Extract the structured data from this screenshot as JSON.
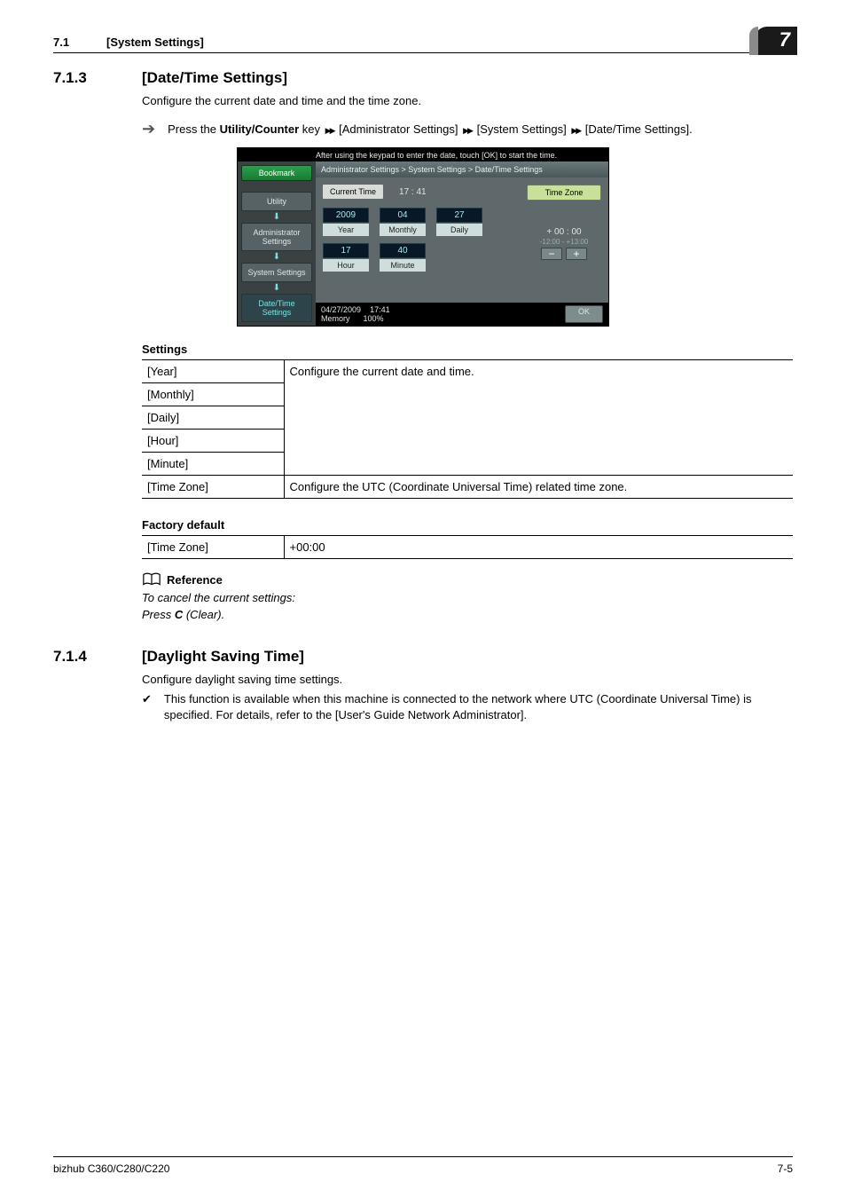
{
  "header": {
    "num": "7.1",
    "text": "[System Settings]",
    "chapter": "7"
  },
  "sec713": {
    "num": "7.1.3",
    "title": "[Date/Time Settings]",
    "intro": "Configure the current date and time and the time zone.",
    "press_pre": "Press the ",
    "press_bold": "Utility/Counter",
    "press_post": " key ",
    "nav1": " [Administrator Settings] ",
    "nav2": " [System Settings] ",
    "nav3": " [Date/Time Settings]."
  },
  "device": {
    "topmsg": "After using the keypad to enter the date, touch [OK] to start the time.",
    "bookmark": "Bookmark",
    "crumbs": {
      "utility": "Utility",
      "admin": "Administrator\nSettings",
      "sys": "System Settings",
      "dt": "Date/Time\nSettings"
    },
    "path": "Administrator Settings > System Settings > Date/Time Settings",
    "current_label": "Current Time",
    "current_value": "17 : 41",
    "fields": {
      "year": {
        "val": "2009",
        "lbl": "Year"
      },
      "month": {
        "val": "04",
        "lbl": "Monthly"
      },
      "day": {
        "val": "27",
        "lbl": "Daily"
      },
      "hour": {
        "val": "17",
        "lbl": "Hour"
      },
      "minute": {
        "val": "40",
        "lbl": "Minute"
      }
    },
    "tz_btn": "Time Zone",
    "tz_val": "+ 00 : 00",
    "tz_range": "-12:00 - +13:00",
    "status_date": "04/27/2009",
    "status_time": "17:41",
    "status_mem_lbl": "Memory",
    "status_mem_val": "100%",
    "ok": "OK"
  },
  "settings_table": {
    "title": "Settings",
    "rows": [
      {
        "k": "[Year]",
        "v": "Configure the current date and time."
      },
      {
        "k": "[Monthly]",
        "v": ""
      },
      {
        "k": "[Daily]",
        "v": ""
      },
      {
        "k": "[Hour]",
        "v": ""
      },
      {
        "k": "[Minute]",
        "v": ""
      },
      {
        "k": "[Time Zone]",
        "v": "Configure the UTC (Coordinate Universal Time) related time zone."
      }
    ]
  },
  "factory_table": {
    "title": "Factory default",
    "rows": [
      {
        "k": "[Time Zone]",
        "v": "+00:00"
      }
    ]
  },
  "reference": {
    "title": "Reference",
    "line1_pre": "To cancel the current settings:",
    "line2_pre": "Press ",
    "line2_bold": "C",
    "line2_post": " (Clear)."
  },
  "sec714": {
    "num": "7.1.4",
    "title": "[Daylight Saving Time]",
    "intro": "Configure daylight saving time settings.",
    "note": "This function is available when this machine is connected to the network where UTC (Coordinate Universal Time) is specified. For details, refer to the [User's Guide Network Administrator]."
  },
  "footer": {
    "left": "bizhub C360/C280/C220",
    "right": "7-5"
  }
}
